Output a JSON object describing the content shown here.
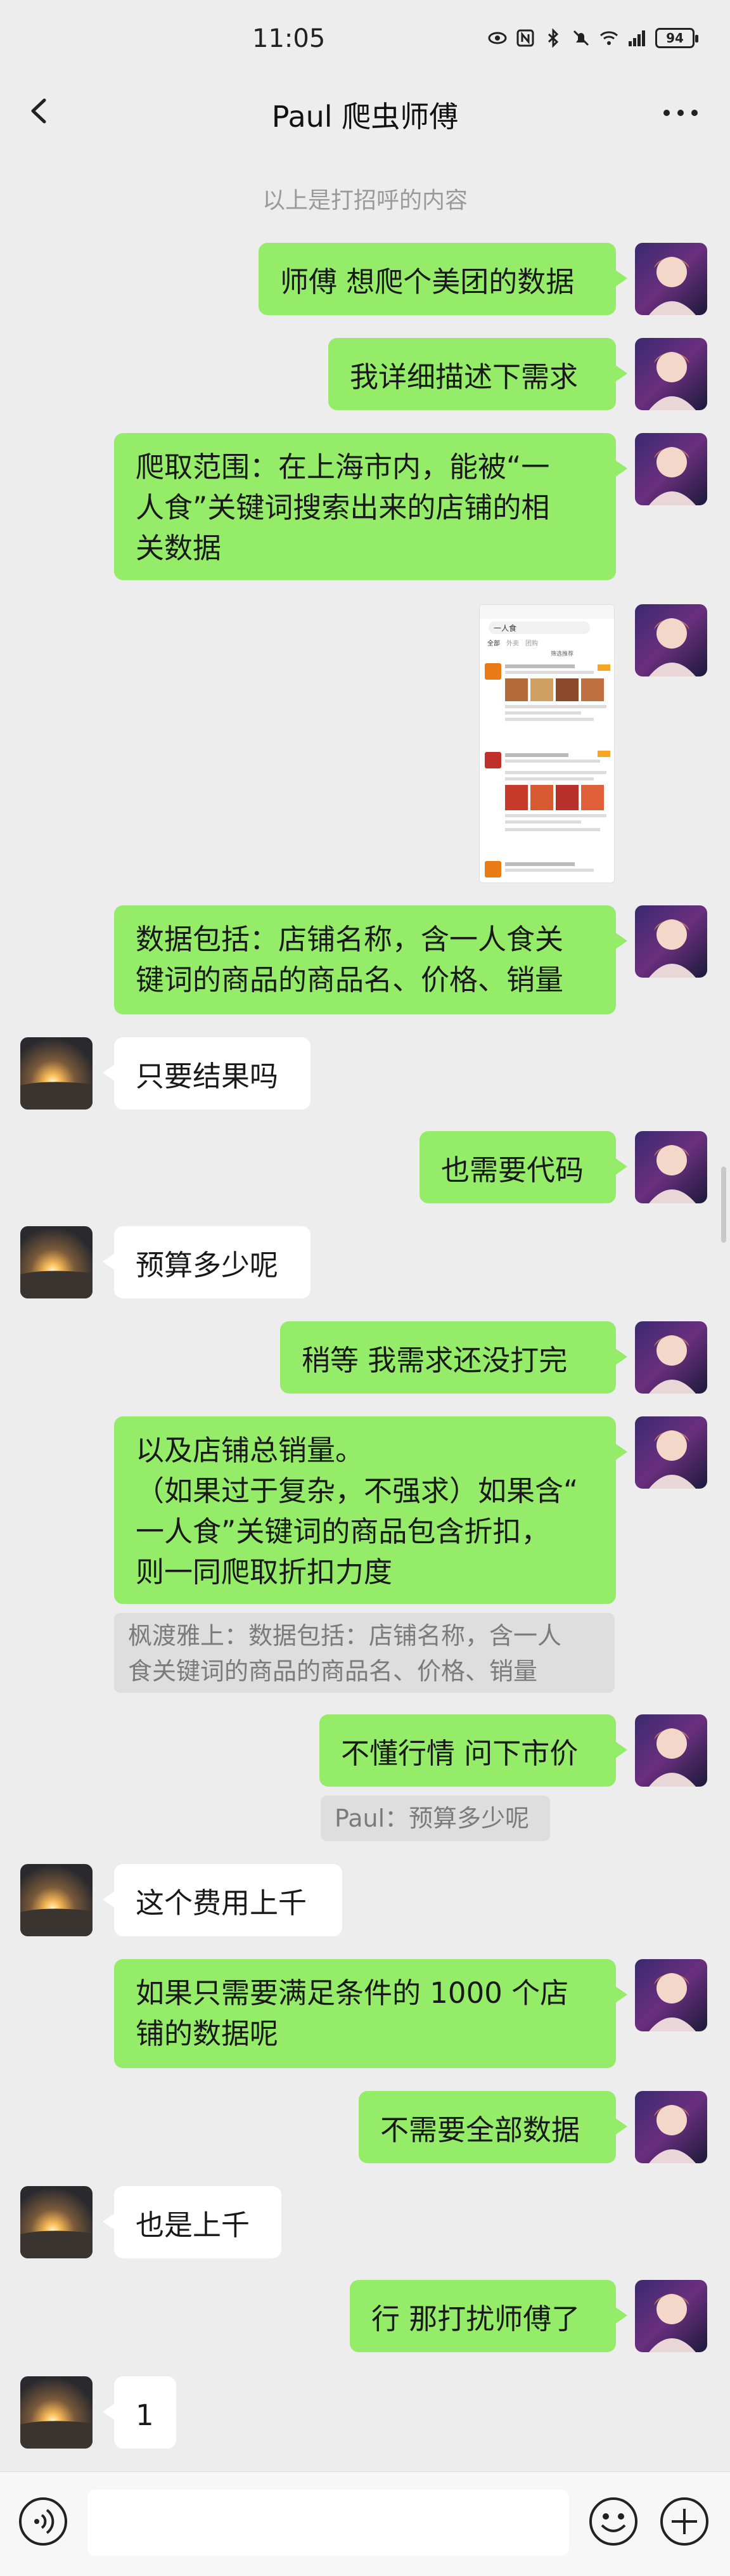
{
  "status": {
    "time": "11:05",
    "battery": "94"
  },
  "header": {
    "title": "Paul 爬虫师傅",
    "back_icon": "chevron-left-icon",
    "more_icon": "more-dots-icon"
  },
  "notice": "以上是打招呼的内容",
  "messages": [
    {
      "from": "me",
      "text": "师傅 想爬个美团的数据"
    },
    {
      "from": "me",
      "text": "我详细描述下需求"
    },
    {
      "from": "me",
      "lines": [
        "爬取范围：在上海市内，能被“一",
        "人食”关键词搜索出来的店铺的相",
        "关数据"
      ]
    },
    {
      "from": "me",
      "type": "image",
      "image": {
        "search": "一人食",
        "tabs": [
          "全部",
          "外卖",
          "团购"
        ],
        "filter": "筛选推荐"
      }
    },
    {
      "from": "me",
      "lines": [
        "数据包括：店铺名称，含一人食关",
        "键词的商品的商品名、价格、销量"
      ]
    },
    {
      "from": "them",
      "text": "只要结果吗"
    },
    {
      "from": "me",
      "text": "也需要代码"
    },
    {
      "from": "them",
      "text": "预算多少呢"
    },
    {
      "from": "me",
      "text": "稍等 我需求还没打完"
    },
    {
      "from": "me",
      "lines": [
        "以及店铺总销量。",
        "（如果过于复杂，不强求）如果含“",
        "一人食”关键词的商品包含折扣，",
        "则一同爬取折扣力度"
      ],
      "quote": [
        "枫渡雅上：数据包括：店铺名称，含一人",
        "食关键词的商品的商品名、价格、销量"
      ]
    },
    {
      "from": "me",
      "text": "不懂行情 问下市价",
      "quote": [
        "Paul：预算多少呢"
      ]
    },
    {
      "from": "them",
      "text": "这个费用上千"
    },
    {
      "from": "me",
      "lines": [
        "如果只需要满足条件的 1000 个店",
        "铺的数据呢"
      ]
    },
    {
      "from": "me",
      "text": "不需要全部数据"
    },
    {
      "from": "them",
      "text": "也是上千"
    },
    {
      "from": "me",
      "text": "行 那打扰师傅了"
    },
    {
      "from": "them",
      "text": "1"
    }
  ],
  "input": {
    "placeholder": "",
    "voice_icon": "voice-icon",
    "emoji_icon": "emoji-icon",
    "plus_icon": "plus-icon"
  }
}
